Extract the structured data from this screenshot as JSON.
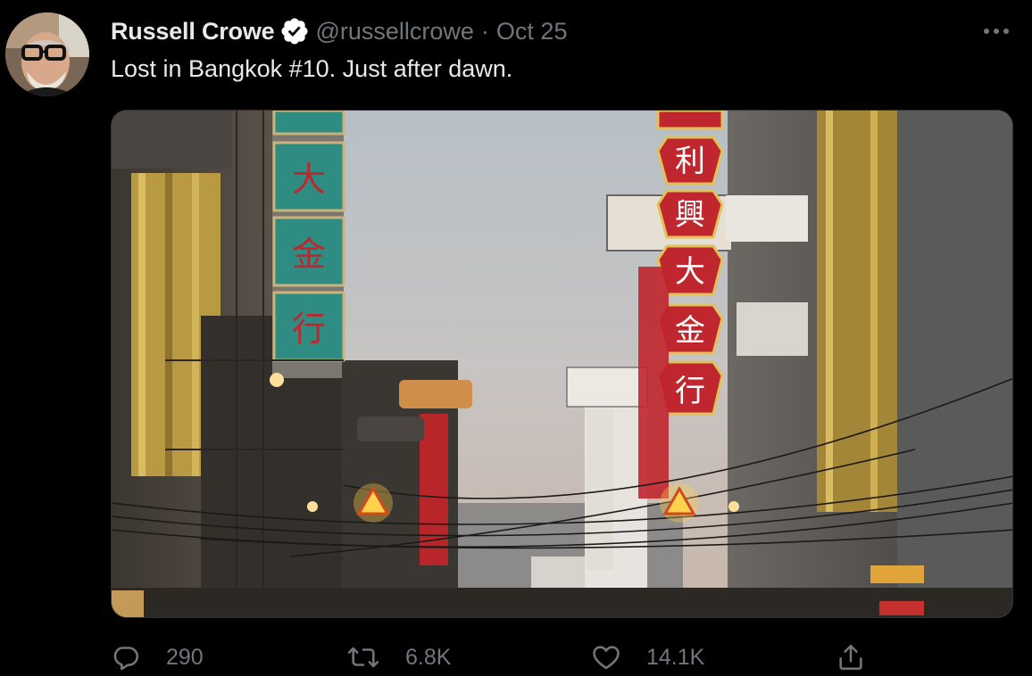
{
  "tweet": {
    "author": {
      "display_name": "Russell Crowe",
      "handle": "@russellcrowe",
      "verified": true
    },
    "separator": "·",
    "date": "Oct 25",
    "text": "Lost in Bangkok #10. Just after dawn.",
    "media": {
      "sign_glyphs_left": [
        "大",
        "金",
        "行"
      ],
      "sign_glyphs_right": [
        "利",
        "興",
        "大",
        "金",
        "行"
      ]
    },
    "stats": {
      "replies": "290",
      "retweets": "6.8K",
      "likes": "14.1K"
    }
  },
  "icons": {
    "verified": "verified-badge-icon",
    "more": "more-dots-icon",
    "reply": "reply-icon",
    "retweet": "retweet-icon",
    "like": "heart-icon",
    "share": "share-icon"
  },
  "colors": {
    "background": "#000000",
    "text_primary": "#e7e9ea",
    "text_secondary": "#71767b",
    "verified_badge": "#ffffff"
  }
}
